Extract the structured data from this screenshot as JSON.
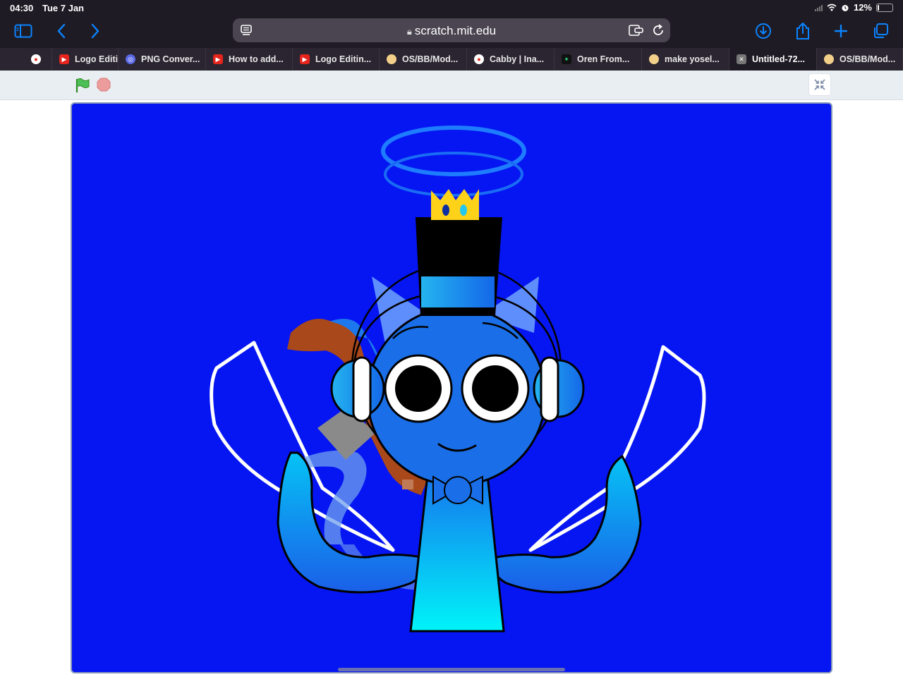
{
  "status": {
    "time": "04:30",
    "date": "Tue 7 Jan",
    "battery": "12%",
    "battery_level": 0.12,
    "icons": [
      "cellular-signal-icon",
      "wifi-icon",
      "alarm-icon",
      "battery-icon"
    ]
  },
  "toolbar": {
    "url": "scratch.mit.edu",
    "icons": [
      "sidebar-icon",
      "back-icon",
      "forward-icon",
      "reader-icon",
      "lock-icon",
      "tab-share-icon",
      "reload-icon",
      "download-icon",
      "share-icon",
      "new-tab-icon",
      "tabs-overview-icon"
    ]
  },
  "tabs": [
    {
      "label": "",
      "favicon": "fire"
    },
    {
      "label": "Logo Editir",
      "favicon": "youtube"
    },
    {
      "label": "PNG Conver...",
      "favicon": "converter"
    },
    {
      "label": "How to add...",
      "favicon": "youtube"
    },
    {
      "label": "Logo Editin...",
      "favicon": "youtube"
    },
    {
      "label": "OS/BB/Mod...",
      "favicon": "bean"
    },
    {
      "label": "Cabby | Ina...",
      "favicon": "fire"
    },
    {
      "label": "Oren From...",
      "favicon": "green"
    },
    {
      "label": "make yosel...",
      "favicon": "bean"
    },
    {
      "label": "Untitled-72...",
      "favicon": "close",
      "active": true
    },
    {
      "label": "OS/BB/Mod...",
      "favicon": "bean"
    }
  ],
  "scratch": {
    "controls": [
      "green-flag-icon",
      "stop-icon",
      "exit-fullscreen-icon"
    ]
  },
  "colors": {
    "stage_bg": "#0516f2",
    "chrome_bg": "#1f1b24",
    "accent": "#0a84ff"
  }
}
